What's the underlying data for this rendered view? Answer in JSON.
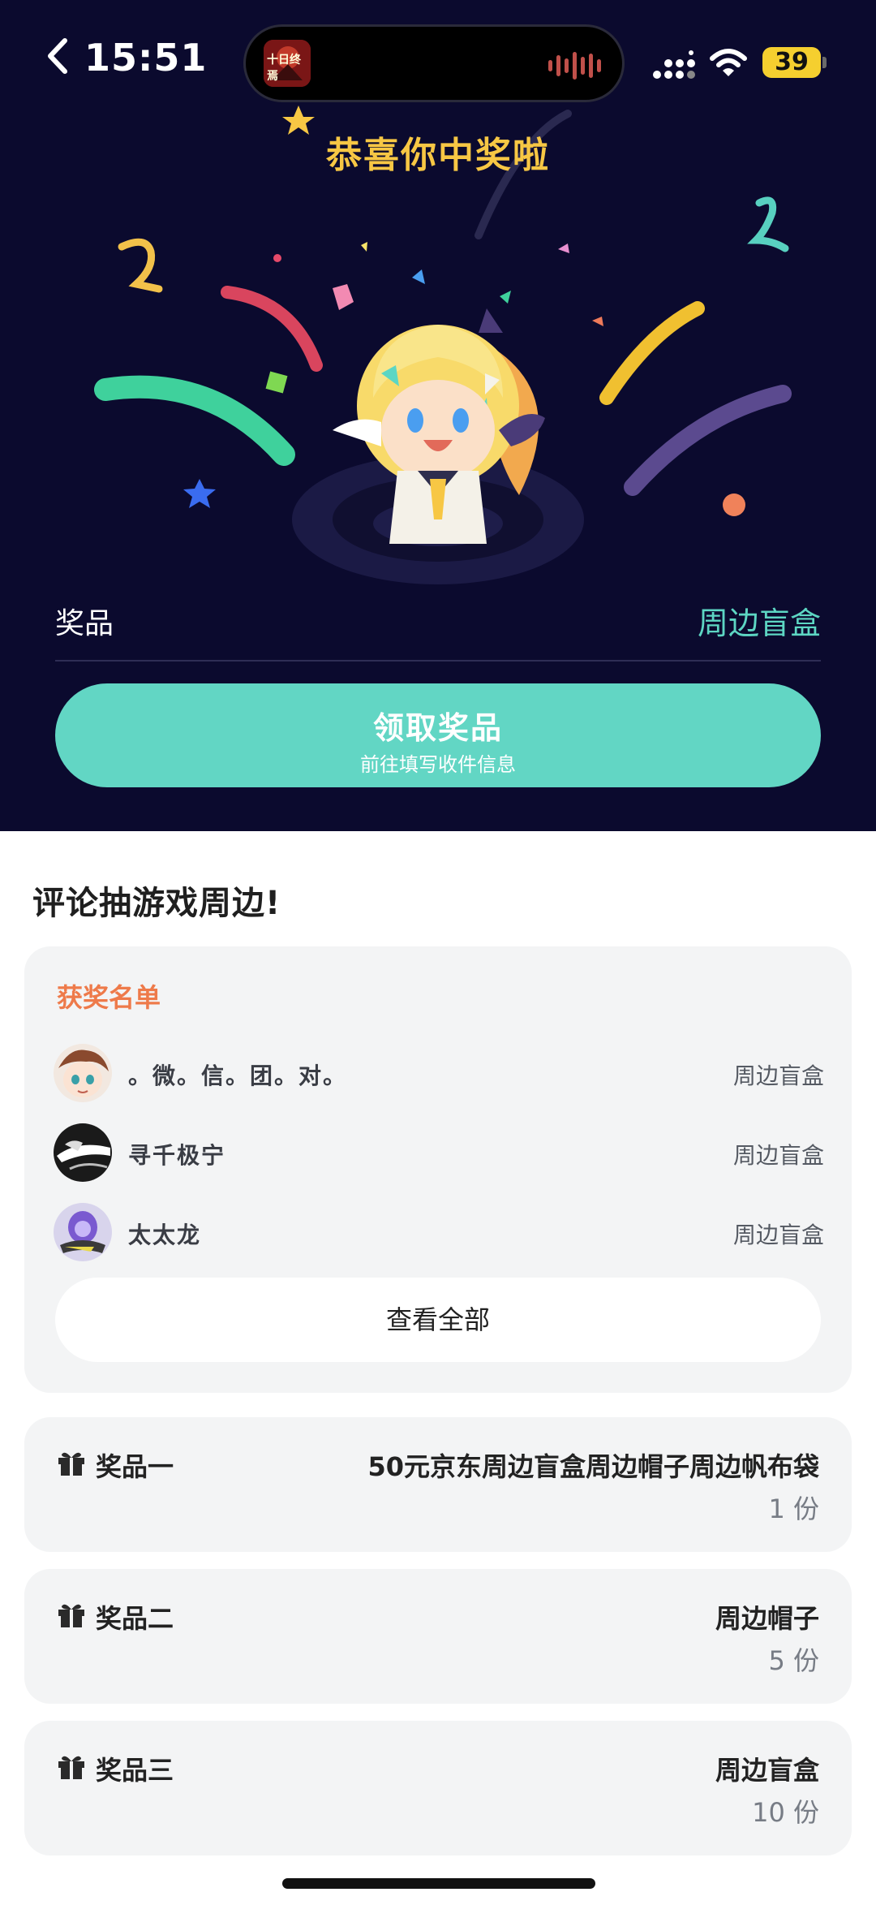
{
  "status_bar": {
    "time": "15:51",
    "battery": "39",
    "island_app_label": "十日终焉"
  },
  "hero": {
    "congrats": "恭喜你中奖啦",
    "prize_label": "奖品",
    "prize_value": "周边盲盒",
    "claim_button": {
      "title": "领取奖品",
      "subtitle": "前往填写收件信息"
    }
  },
  "section": {
    "title": "评论抽游戏周边!"
  },
  "winners": {
    "title": "获奖名单",
    "items": [
      {
        "name": "。微。信。团。对。",
        "prize": "周边盲盒",
        "avatar": "anime-boy-avatar"
      },
      {
        "name": "寻千极宁",
        "prize": "周边盲盒",
        "avatar": "black-white-avatar"
      },
      {
        "name": "太太龙",
        "prize": "周边盲盒",
        "avatar": "purple-character-avatar"
      }
    ],
    "view_all": "查看全部"
  },
  "prizes": [
    {
      "tier": "奖品一",
      "name": "50元京东周边盲盒周边帽子周边帆布袋",
      "count": "1 份"
    },
    {
      "tier": "奖品二",
      "name": "周边帽子",
      "count": "5 份"
    },
    {
      "tier": "奖品三",
      "name": "周边盲盒",
      "count": "10 份"
    }
  ],
  "colors": {
    "hero_bg": "#0b0a2e",
    "accent_teal": "#62d6c4",
    "gold": "#f7c744",
    "winners_title": "#ee7a4a",
    "card_bg": "#f3f4f5"
  }
}
